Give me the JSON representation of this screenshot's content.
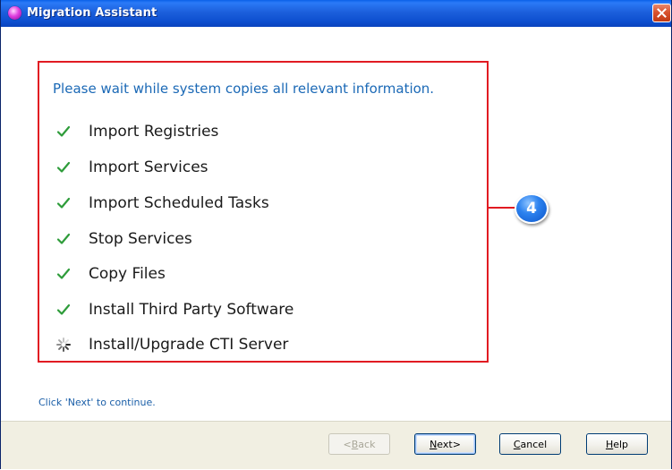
{
  "window": {
    "title": "Migration Assistant"
  },
  "content": {
    "instruction": "Please wait while system copies all relevant information.",
    "tasks": [
      {
        "label": "Import Registries",
        "status": "done"
      },
      {
        "label": "Import Services",
        "status": "done"
      },
      {
        "label": "Import Scheduled Tasks",
        "status": "done"
      },
      {
        "label": "Stop Services",
        "status": "done"
      },
      {
        "label": "Copy Files",
        "status": "done"
      },
      {
        "label": "Install Third Party Software",
        "status": "done"
      },
      {
        "label": "Install/Upgrade CTI Server",
        "status": "in-progress"
      }
    ],
    "callout_number": "4",
    "footer_hint": "Click 'Next' to continue."
  },
  "buttons": {
    "back": {
      "key": "B",
      "rest": "ack",
      "prefix": "< ",
      "suffix": "",
      "enabled": false
    },
    "next": {
      "key": "N",
      "rest": "ext",
      "prefix": "",
      "suffix": " >",
      "enabled": true
    },
    "cancel": {
      "key": "C",
      "rest": "ancel",
      "prefix": "",
      "suffix": "",
      "enabled": true
    },
    "help": {
      "key": "H",
      "rest": "elp",
      "prefix": "",
      "suffix": "",
      "enabled": true
    }
  },
  "colors": {
    "check": "#2e9c3a",
    "highlight_border": "#e11b22",
    "instruction_text": "#1b69b6"
  },
  "icons": {
    "done": "check-icon",
    "in_progress": "spinner-icon",
    "close": "close-icon",
    "app": "app-icon"
  }
}
